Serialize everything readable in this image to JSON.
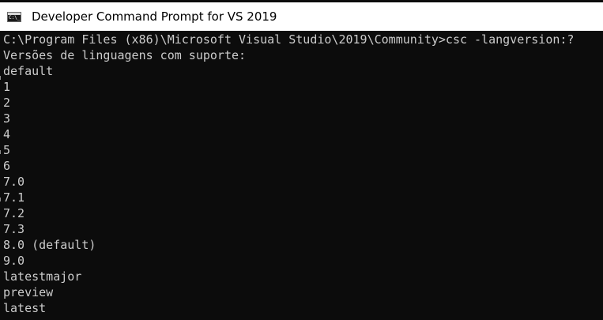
{
  "window": {
    "title": "Developer Command Prompt for VS 2019",
    "icon": "console-app-icon",
    "icon_glyph": "C:\\_",
    "background": "#0c0c0c",
    "text_color": "#cccccc"
  },
  "console": {
    "lines": [
      "C:\\Program Files (x86)\\Microsoft Visual Studio\\2019\\Community>csc -langversion:?",
      "Versões de linguagens com suporte:",
      "default",
      "1",
      "2",
      "3",
      "4",
      "5",
      "6",
      "7.0",
      "7.1",
      "7.2",
      "7.3",
      "8.0 (default)",
      "9.0",
      "latestmajor",
      "preview",
      "latest"
    ]
  }
}
